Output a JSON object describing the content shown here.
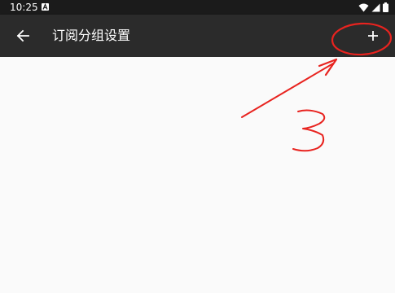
{
  "status_bar": {
    "time": "10:25",
    "notification_icon": "a-badge-icon",
    "icons": [
      "wifi-icon",
      "signal-icon",
      "battery-icon"
    ]
  },
  "app_bar": {
    "title": "订阅分组设置",
    "back_icon": "arrow-back-icon",
    "add_icon": "plus-icon"
  },
  "annotation": {
    "label": "3",
    "color": "#e8231f"
  },
  "colors": {
    "status_bar": "#1b1b1b",
    "app_bar": "#2b2b2b",
    "background": "#fafafa"
  }
}
